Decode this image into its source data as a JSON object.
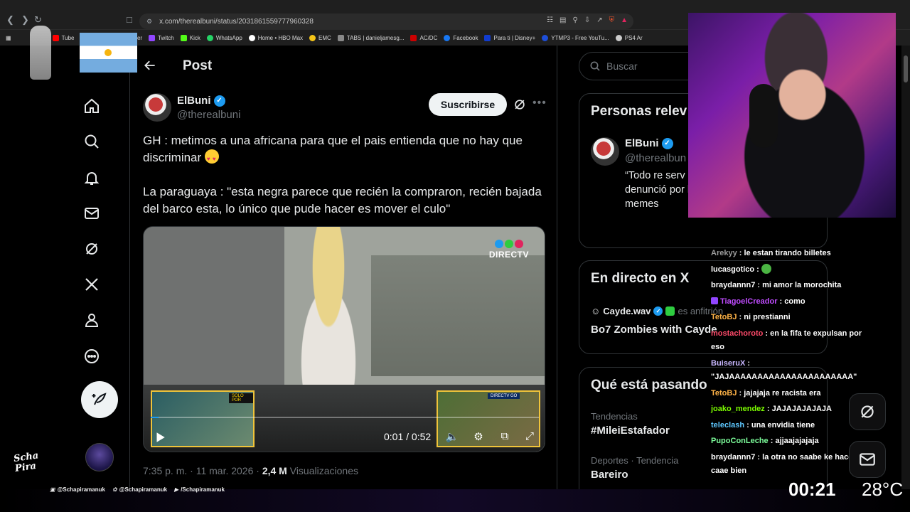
{
  "browser": {
    "url": "x.com/therealbuni/status/2031861559777960328",
    "bookmarks": [
      "Tube",
      "Twitter",
      "Twitch",
      "Kick",
      "WhatsApp",
      "Home • HBO Max",
      "EMC",
      "TABS | danieljamesg...",
      "AC/DC",
      "Facebook",
      "Para ti | Disney+",
      "YTMP3 - Free YouTu...",
      "PS4 Ar"
    ]
  },
  "main": {
    "title": "Post",
    "author": {
      "name": "ElBuni",
      "handle": "@therealbuni"
    },
    "subscribe_label": "Suscribirse",
    "text1": "GH : metimos a una africana para que el pais entienda que no hay que discriminar",
    "text2": "La paraguaya : \"esta negra parece que recién la compraron, recién bajada del barco esta, lo único que pude hacer es mover el culo\"",
    "video": {
      "brand": "DIRECTV",
      "time": "0:01 / 0:52",
      "progress": 0.02,
      "pip_left_tag": "SOLO POR",
      "pip_right_tag": "DIRECTV GO"
    },
    "meta": {
      "time": "7:35 p. m. · 11 mar. 2026 · ",
      "views": "2,4 M",
      "views_label": " Visualizaciones"
    }
  },
  "sidebar": {
    "search_placeholder": "Buscar",
    "related": {
      "title": "Personas relev",
      "name": "ElBuni",
      "handle": "@therealbun",
      "bio": "“Todo re serv occidente..” - planero- la je denunció por hacerlo perder al mando con memes"
    },
    "live": {
      "title": "En directo en X",
      "host": "Cayde.wav",
      "host_suffix": "es anfitrión",
      "stream_title": "Bo7 Zombies with Cayde"
    },
    "trends": {
      "title": "Qué está pasando",
      "items": [
        {
          "context": "Tendencias",
          "name": "#MileiEstafador"
        },
        {
          "context": "Deportes · Tendencia",
          "name": "Bareiro"
        }
      ]
    }
  },
  "chat": [
    {
      "user": "Arekyy",
      "color": "#9b9b9b",
      "msg": "le estan tirando billetes"
    },
    {
      "user": "lucasgotico",
      "color": "#ffffff",
      "msg": "",
      "emote": true
    },
    {
      "user": "braydannn7",
      "color": "#ffffff",
      "msg": "mi amor la morochita"
    },
    {
      "user": "TiagoelCreador",
      "color": "#c04cff",
      "msg": "como",
      "badge": true
    },
    {
      "user": "TetoBJ",
      "color": "#ffb347",
      "msg": "ni prestianni"
    },
    {
      "user": "mostachoroto",
      "color": "#ff4a6a",
      "msg": "en la fifa te expulsan por eso",
      "wrap": true
    },
    {
      "user": "BuiseruX",
      "color": "#c9b8ff",
      "msg": "\"JAJAAAAAAAAAAAAAAAAAAAAAA\"",
      "wrap": true
    },
    {
      "user": "TetoBJ",
      "color": "#ffb347",
      "msg": "jajajaja re racista era"
    },
    {
      "user": "joako_mendez",
      "color": "#7cfc00",
      "msg": "JAJAJAJAJAJA"
    },
    {
      "user": "teleclash",
      "color": "#5ec8ff",
      "msg": "una envidia tiene"
    },
    {
      "user": "PupoConLeche",
      "color": "#7cfc9a",
      "msg": "ajjaajajajaja"
    },
    {
      "user": "braydannn7",
      "color": "#ffffff",
      "msg": "la otra no saabe ke hace pa caae bien",
      "wrap": true
    }
  ],
  "overlay": {
    "clock": "00:21",
    "temp": "28°C",
    "socials": [
      "@Schapiramanuk",
      "@Schapiramanuk",
      "/Schapiramanuk"
    ],
    "watermark": "Scha Pira"
  },
  "colors": {
    "accent": "#1d9bf0",
    "bg": "#000000",
    "border": "#2f3336"
  }
}
